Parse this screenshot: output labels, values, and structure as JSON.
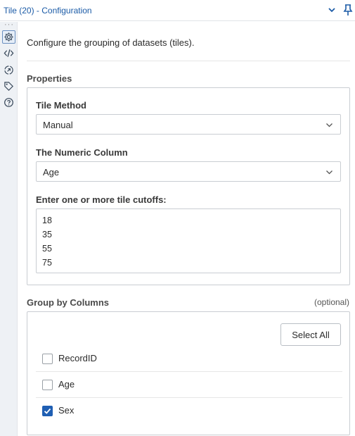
{
  "titlebar": {
    "title": "Tile (20) - Configuration"
  },
  "rail": {
    "items": [
      "gear-icon",
      "code-icon",
      "annotation-icon",
      "tag-icon",
      "help-icon"
    ]
  },
  "intro": "Configure the grouping of datasets (tiles).",
  "properties": {
    "heading": "Properties",
    "tile_method": {
      "label": "Tile Method",
      "value": "Manual"
    },
    "numeric_column": {
      "label": "The Numeric Column",
      "value": "Age"
    },
    "cutoffs": {
      "label": "Enter one or more tile cutoffs:",
      "values": [
        "18",
        "35",
        "55",
        "75"
      ]
    }
  },
  "group_by": {
    "heading": "Group by Columns",
    "optional": "(optional)",
    "select_all": "Select All",
    "columns": [
      {
        "name": "RecordID",
        "checked": false
      },
      {
        "name": "Age",
        "checked": false
      },
      {
        "name": "Sex",
        "checked": true
      }
    ]
  },
  "colors": {
    "accent": "#1f5fb3",
    "title": "#1a5aa6"
  }
}
